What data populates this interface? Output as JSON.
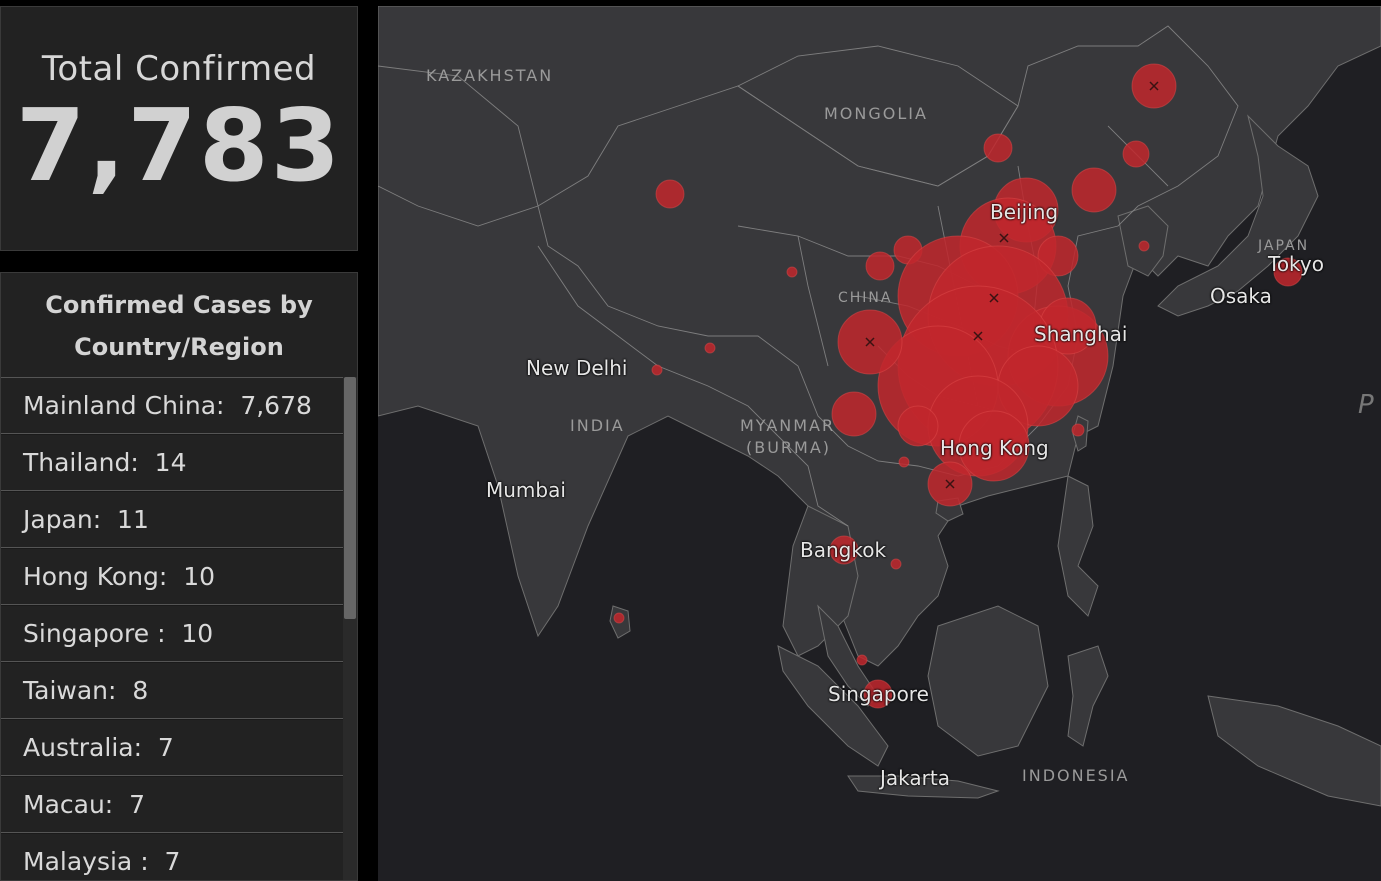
{
  "total": {
    "label": "Total Confirmed",
    "value": "7,783"
  },
  "list": {
    "title_line1": "Confirmed Cases by",
    "title_line2": "Country/Region",
    "items": [
      "Mainland China:  7,678",
      "Thailand:  14",
      "Japan:  11",
      "Hong Kong:  10",
      "Singapore :  10",
      "Taiwan:  8",
      "Australia:  7",
      "Macau:  7",
      "Malaysia :  7"
    ]
  },
  "map": {
    "countries": {
      "kazakhstan": "KAZAKHSTAN",
      "mongolia": "MONGOLIA",
      "china": "CHINA",
      "india": "INDIA",
      "myanmar_line1": "MYANMAR",
      "myanmar_line2": "(BURMA)",
      "japan": "JAPAN",
      "indonesia": "INDONESIA",
      "partial": "P"
    },
    "cities": {
      "beijing": "Beijing",
      "shanghai": "Shanghai",
      "hong_kong": "Hong Kong",
      "new_delhi": "New Delhi",
      "mumbai": "Mumbai",
      "bangkok": "Bangkok",
      "singapore": "Singapore",
      "jakarta": "Jakarta",
      "tokyo": "Tokyo",
      "osaka": "Osaka"
    },
    "colors": {
      "water": "#1f1f23",
      "land": "#3a3a3d",
      "border": "#7d7d7d",
      "bubble": "#c1272d"
    }
  }
}
